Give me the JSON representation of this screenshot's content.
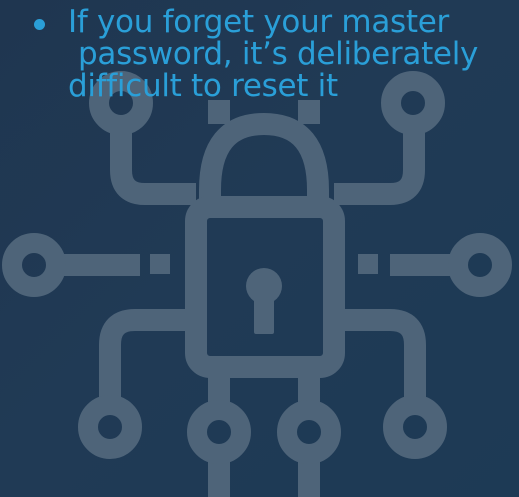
{
  "slide": {
    "bullet_lines": [
      "If you forget your master",
      "password, it’s deliberately",
      "difficult to reset it"
    ],
    "emblem_icon": "circuit-padlock-icon"
  },
  "colors": {
    "background": "#203a55",
    "bullet_text": "#2a9fd8",
    "emblem": "#4e6479"
  }
}
